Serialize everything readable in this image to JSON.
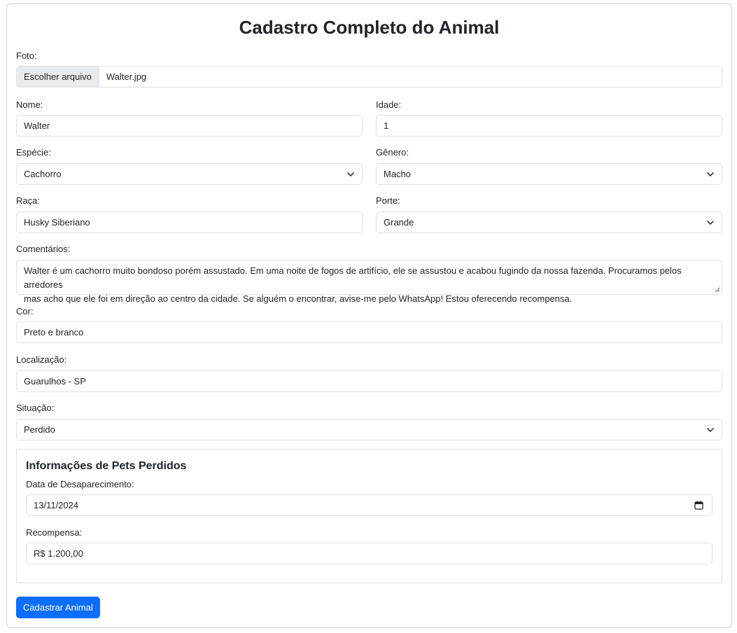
{
  "page": {
    "title": "Cadastro Completo do Animal"
  },
  "foto": {
    "label": "Foto:",
    "button": "Escolher arquivo",
    "filename": "Walter.jpg"
  },
  "nome": {
    "label": "Nome:",
    "value": "Walter"
  },
  "idade": {
    "label": "Idade:",
    "value": "1"
  },
  "especie": {
    "label": "Espécie:",
    "value": "Cachorro"
  },
  "genero": {
    "label": "Gênero:",
    "value": "Macho"
  },
  "raca": {
    "label": "Raça:",
    "value": "Husky Siberiano"
  },
  "porte": {
    "label": "Porte:",
    "value": "Grande"
  },
  "comentarios": {
    "label": "Comentários:",
    "line1": "Walter é um cachorro muito bondoso porém assustado. Em uma noite de fogos de artifício, ele se assustou e acabou fugindo da nossa fazenda. Procuramos pelos arredores",
    "line2": "mas acho que ele foi em direção ao centro da cidade. Se alguém o encontrar, avise-me pelo WhatsApp! Estou oferecendo recompensa."
  },
  "cor": {
    "label": "Cor:",
    "value": "Preto e branco"
  },
  "localizacao": {
    "label": "Localização:",
    "value": "Guarulhos - SP"
  },
  "situacao": {
    "label": "Situação:",
    "value": "Perdido"
  },
  "perdidos": {
    "title": "Informações de Pets Perdidos",
    "data_label": "Data de Desaparecimento:",
    "data_value": "13/11/2024",
    "recompensa_label": "Recompensa:",
    "recompensa_value": "R$ 1.200,00"
  },
  "submit": {
    "label": "Cadastrar Animal"
  },
  "colors": {
    "primary": "#0d6efd",
    "border": "#dee2e6",
    "file_button_bg": "#e9ecef"
  },
  "icons": {
    "select": "chevron-down-icon",
    "date": "calendar-icon"
  }
}
